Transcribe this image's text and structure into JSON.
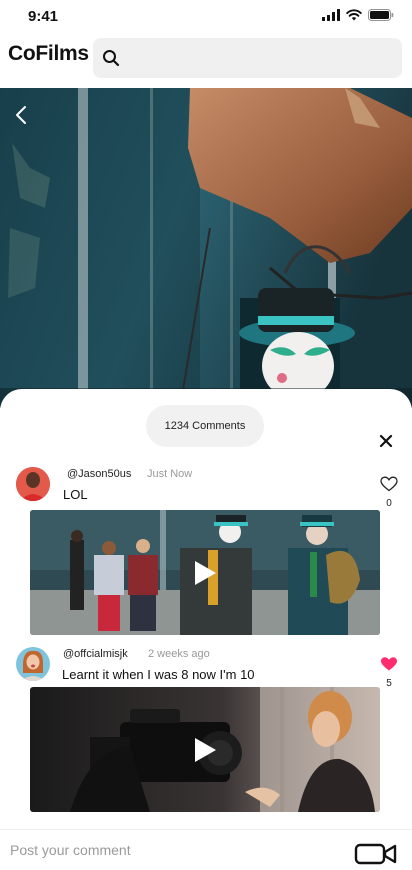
{
  "status_bar": {
    "time": "9:41"
  },
  "header": {
    "app_title": "CoFilms",
    "search_placeholder": ""
  },
  "hero": {
    "back_icon": "chevron-left-icon"
  },
  "comments_panel": {
    "count_label": "1234 Comments",
    "close_icon": "close-icon",
    "comments": [
      {
        "username": "@Jason50us",
        "time": "Just Now",
        "text": "LOL",
        "likes": "0",
        "liked": false,
        "media": "street-performers-video"
      },
      {
        "username": "@offcialmisjk",
        "time": "2 weeks ago",
        "text": "Learnt it when I was 8 now I'm 10",
        "likes": "5",
        "liked": true,
        "media": "film-camera-video"
      }
    ]
  },
  "composer": {
    "placeholder": "Post your comment",
    "camera_icon": "video-camera-icon"
  },
  "colors": {
    "accent_pink": "#ff2d6f",
    "pill_bg": "#f1f1f1",
    "search_bg": "#f0f0f0"
  }
}
